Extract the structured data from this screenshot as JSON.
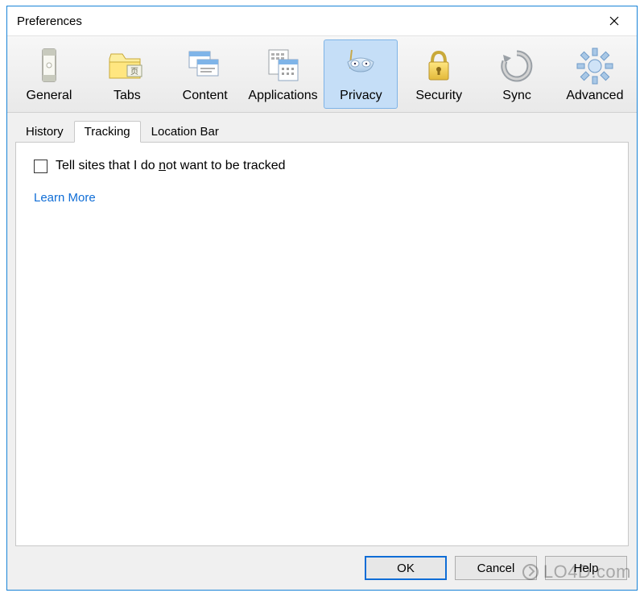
{
  "window": {
    "title": "Preferences"
  },
  "toolbar": {
    "items": [
      {
        "id": "general",
        "label": "General",
        "icon": "general-icon"
      },
      {
        "id": "tabs",
        "label": "Tabs",
        "icon": "tabs-icon"
      },
      {
        "id": "content",
        "label": "Content",
        "icon": "content-icon"
      },
      {
        "id": "applications",
        "label": "Applications",
        "icon": "applications-icon"
      },
      {
        "id": "privacy",
        "label": "Privacy",
        "icon": "privacy-icon",
        "selected": true
      },
      {
        "id": "security",
        "label": "Security",
        "icon": "security-icon"
      },
      {
        "id": "sync",
        "label": "Sync",
        "icon": "sync-icon"
      },
      {
        "id": "advanced",
        "label": "Advanced",
        "icon": "advanced-icon"
      }
    ]
  },
  "tabs": {
    "items": [
      {
        "id": "history",
        "label": "History"
      },
      {
        "id": "tracking",
        "label": "Tracking",
        "active": true
      },
      {
        "id": "locationbar",
        "label": "Location Bar"
      }
    ]
  },
  "tracking_panel": {
    "checkbox_label_pre": "Tell sites that I do ",
    "checkbox_label_key": "n",
    "checkbox_label_post": "ot want to be tracked",
    "checkbox_checked": false,
    "learn_more": "Learn More"
  },
  "footer": {
    "ok": "OK",
    "cancel": "Cancel",
    "help": "Help"
  },
  "watermark": "LO4D.com",
  "colors": {
    "accent": "#1883d7",
    "selected_bg": "#c5def7",
    "link": "#0f6dd6"
  }
}
